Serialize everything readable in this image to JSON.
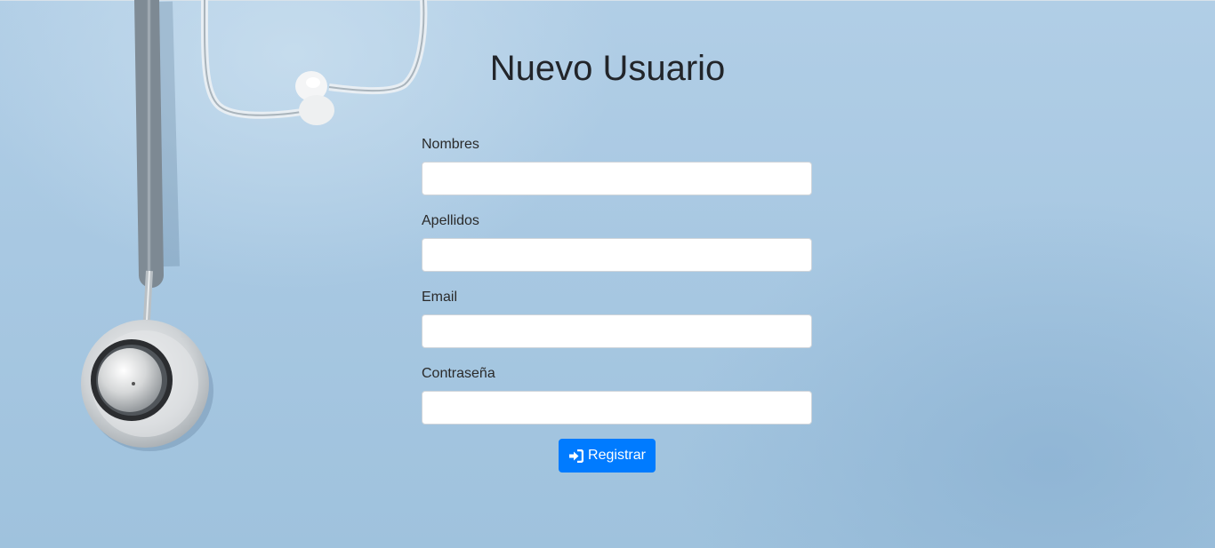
{
  "page": {
    "title": "Nuevo Usuario"
  },
  "form": {
    "fields": [
      {
        "label": "Nombres",
        "value": "",
        "type": "text"
      },
      {
        "label": "Apellidos",
        "value": "",
        "type": "text"
      },
      {
        "label": "Email",
        "value": "",
        "type": "email"
      },
      {
        "label": "Contraseña",
        "value": "",
        "type": "password"
      }
    ],
    "submit": {
      "label": "Registrar",
      "icon": "sign-in-icon",
      "color": "#007bff"
    }
  },
  "background": {
    "image": "stethoscope-photo",
    "color": "#a8c8e2"
  }
}
